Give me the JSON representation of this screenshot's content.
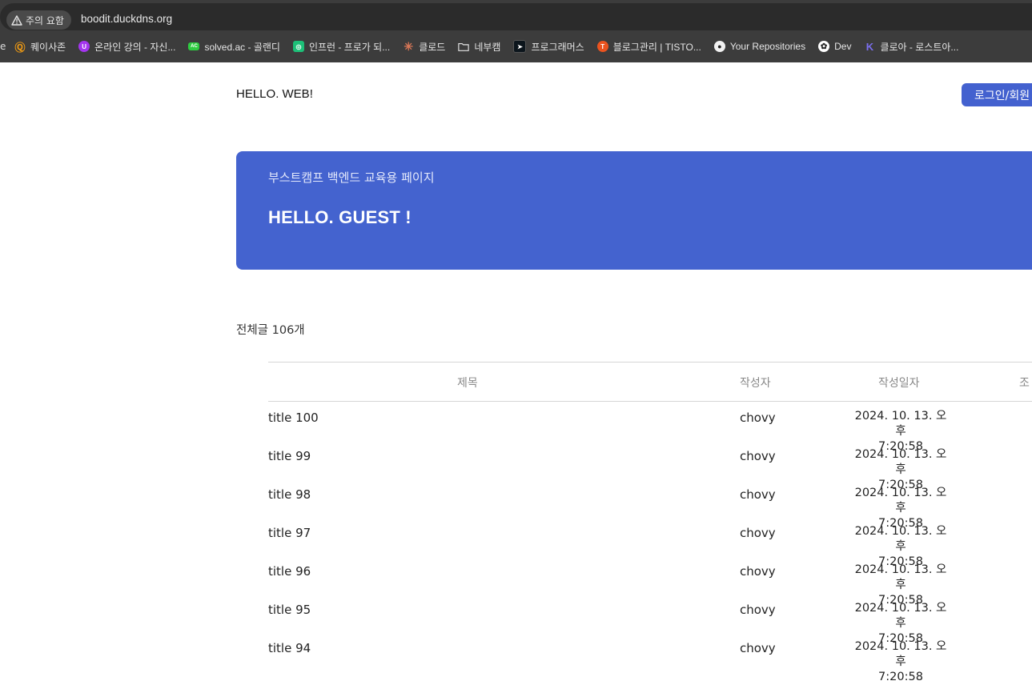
{
  "browser": {
    "security_label": "주의 요함",
    "url": "boodit.duckdns.org",
    "bookmark_lead": "e",
    "bookmarks": [
      {
        "label": "퀘이사존",
        "icon": "quasarzone-icon",
        "color": "#f39c12"
      },
      {
        "label": "온라인 강의 - 자신...",
        "icon": "udemy-icon",
        "color": "#a435f0"
      },
      {
        "label": "solved.ac - 골랜디",
        "icon": "solvedac-icon",
        "color": "#2ecc40"
      },
      {
        "label": "인프런 - 프로가 되...",
        "icon": "inflearn-icon",
        "color": "#1dc078"
      },
      {
        "label": "클로드",
        "icon": "claude-icon",
        "color": "#d97757"
      },
      {
        "label": "네부캠",
        "icon": "folder-icon",
        "color": "#3c3c3c"
      },
      {
        "label": "프로그래머스",
        "icon": "programmers-icon",
        "color": "#0c151c"
      },
      {
        "label": "블로그관리 | TISTO...",
        "icon": "tistory-icon",
        "color": "#eb531f"
      },
      {
        "label": "Your Repositories",
        "icon": "github-icon",
        "color": "#3c3c3c"
      },
      {
        "label": "Dev",
        "icon": "chatgpt-icon",
        "color": "#ffffff"
      },
      {
        "label": "클로아 - 로스트아...",
        "icon": "kloa-icon",
        "color": "#5b4fe0"
      }
    ]
  },
  "header": {
    "brand": "HELLO. WEB!",
    "login_label": "로그인/회원"
  },
  "hero": {
    "subtitle": "부스트캠프 백엔드 교육용 페이지",
    "title": "HELLO. GUEST !"
  },
  "posts": {
    "count_label": "전체글 106개",
    "columns": {
      "title": "제목",
      "author": "작성자",
      "date": "작성일자",
      "extra": "조"
    },
    "rows": [
      {
        "title": "title 100",
        "author": "chovy",
        "date_line1": "2024. 10. 13. 오후",
        "date_line2": "7:20:58"
      },
      {
        "title": "title 99",
        "author": "chovy",
        "date_line1": "2024. 10. 13. 오후",
        "date_line2": "7:20:58"
      },
      {
        "title": "title 98",
        "author": "chovy",
        "date_line1": "2024. 10. 13. 오후",
        "date_line2": "7:20:58"
      },
      {
        "title": "title 97",
        "author": "chovy",
        "date_line1": "2024. 10. 13. 오후",
        "date_line2": "7:20:58"
      },
      {
        "title": "title 96",
        "author": "chovy",
        "date_line1": "2024. 10. 13. 오후",
        "date_line2": "7:20:58"
      },
      {
        "title": "title 95",
        "author": "chovy",
        "date_line1": "2024. 10. 13. 오후",
        "date_line2": "7:20:58"
      },
      {
        "title": "title 94",
        "author": "chovy",
        "date_line1": "2024. 10. 13. 오후",
        "date_line2": "7:20:58"
      }
    ]
  },
  "colors": {
    "accent": "#4463cf",
    "chrome": "#3c3c3c"
  }
}
